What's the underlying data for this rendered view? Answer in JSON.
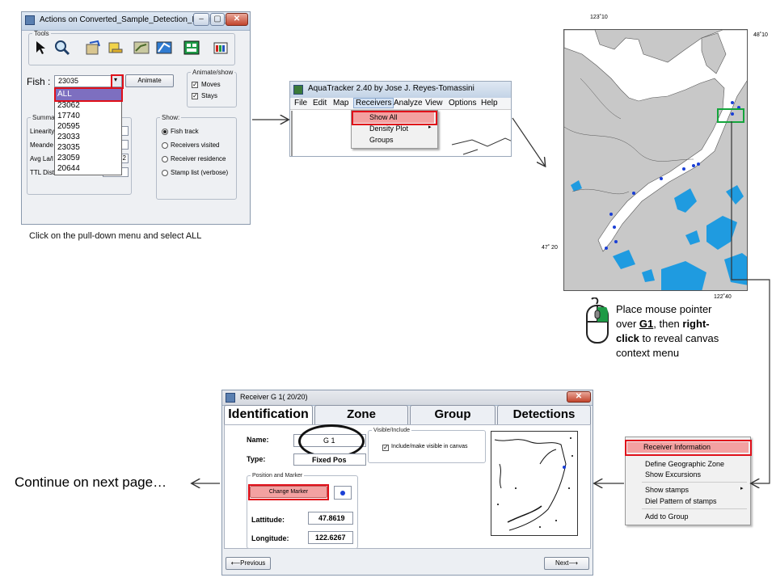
{
  "window1": {
    "title": "Actions on Converted_Sample_Detection_File_not_fo...",
    "tools_legend": "Tools",
    "fish_label": "Fish :",
    "fish_value": "23035",
    "animate_button": "Animate",
    "animate_legend": "Animate/show",
    "moves_label": "Moves",
    "stays_label": "Stays",
    "summary_legend": "Summar",
    "summary_rows": [
      "Linearity",
      "Meande",
      "Avg La/l",
      "TTL Dist"
    ],
    "summary_value_partial": "2",
    "show_legend": "Show:",
    "show_options": [
      "Fish track",
      "Receivers visited",
      "Receiver residence",
      "Stamp list (verbose)"
    ],
    "dropdown_items": [
      "ALL",
      "23062",
      "17740",
      "20595",
      "23033",
      "23035",
      "23059",
      "20644"
    ]
  },
  "caption1": "Click on the pull-down menu and select ALL",
  "window2": {
    "title": "AquaTracker 2.40 by Jose J. Reyes-Tomassini",
    "menu": [
      "File",
      "Edit",
      "Map",
      "Receivers",
      "Analyze",
      "View",
      "Options",
      "Help"
    ],
    "receivers_menu": [
      "Show All",
      "Density Plot",
      "Groups"
    ]
  },
  "map": {
    "lon_top": "123˚10",
    "lat_top_right": "48˚10",
    "lat_left": "47˚ 20",
    "lon_bottom": "122˚40",
    "water_color": "#ffffff",
    "land_color": "#c8c8c8",
    "lake_color": "#1f9be0",
    "receiver_color": "#1a3fd6"
  },
  "instruction": {
    "line1": "Place mouse pointer",
    "line2_a": "over ",
    "line2_b": "G1",
    "line2_c": ", then ",
    "line2_d": "right-",
    "line3_a": "click",
    "line3_b": " to reveal canvas",
    "line4": "context menu"
  },
  "context_menu": [
    "Receiver Information",
    "Define Geographic Zone",
    "Show Excursions",
    "Show stamps",
    "Diel Pattern of stamps",
    "Add to Group"
  ],
  "window3": {
    "title": "Receiver G 1( 20/20)",
    "tabs": [
      "Identification",
      "Zone",
      "Group",
      "Detections"
    ],
    "name_label": "Name:",
    "name_value": "G 1",
    "type_label": "Type:",
    "type_value": "Fixed Pos",
    "visible_legend": "Visible/Include",
    "visible_check_label": "Include/make visible in canvas",
    "pos_legend": "Position and Marker",
    "change_marker_button": "Change Marker",
    "lat_label": "Lattitude:",
    "lat_value": "47.8619",
    "lon_label": "Longitude:",
    "lon_value": "122.6267",
    "prev_button": "⟵Previous",
    "next_button": "Next⟶"
  },
  "continue_text": "Continue on next page…"
}
